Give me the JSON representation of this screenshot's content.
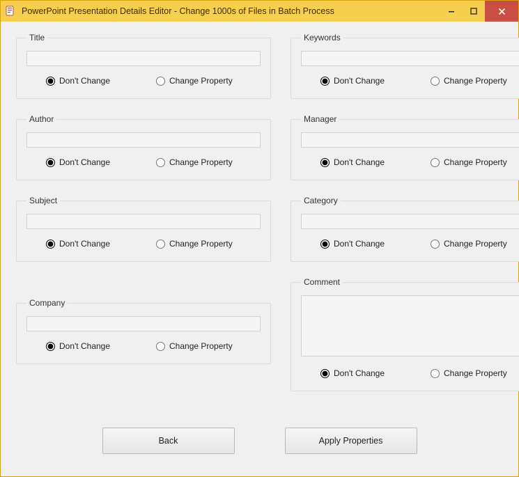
{
  "window": {
    "title": "PowerPoint Presentation Details Editor - Change 1000s of Files in Batch Process"
  },
  "groups": {
    "title": {
      "legend": "Title",
      "value": "",
      "dont_change": "Don't Change",
      "change_prop": "Change Property"
    },
    "author": {
      "legend": "Author",
      "value": "",
      "dont_change": "Don't Change",
      "change_prop": "Change Property"
    },
    "subject": {
      "legend": "Subject",
      "value": "",
      "dont_change": "Don't Change",
      "change_prop": "Change Property"
    },
    "company": {
      "legend": "Company",
      "value": "",
      "dont_change": "Don't Change",
      "change_prop": "Change Property"
    },
    "keywords": {
      "legend": "Keywords",
      "value": "",
      "dont_change": "Don't Change",
      "change_prop": "Change Property"
    },
    "manager": {
      "legend": "Manager",
      "value": "",
      "dont_change": "Don't Change",
      "change_prop": "Change Property"
    },
    "category": {
      "legend": "Category",
      "value": "",
      "dont_change": "Don't Change",
      "change_prop": "Change Property"
    },
    "comment": {
      "legend": "Comment",
      "value": "",
      "dont_change": "Don't Change",
      "change_prop": "Change Property"
    }
  },
  "buttons": {
    "back": "Back",
    "apply": "Apply Properties"
  }
}
